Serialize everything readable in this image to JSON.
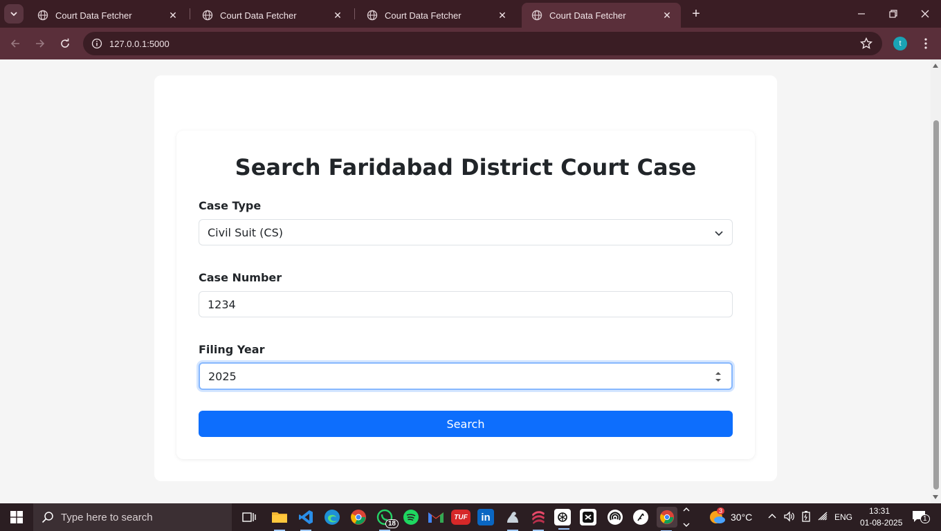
{
  "browser": {
    "tabs": [
      {
        "title": "Court Data Fetcher"
      },
      {
        "title": "Court Data Fetcher"
      },
      {
        "title": "Court Data Fetcher"
      },
      {
        "title": "Court Data Fetcher"
      }
    ],
    "active_tab_index": 3,
    "url": "127.0.0.1:5000",
    "profile_initial": "t",
    "theme_color": "#5a2f3a"
  },
  "form": {
    "title": "Search Faridabad District Court Case",
    "case_type": {
      "label": "Case Type",
      "value": "Civil Suit (CS)"
    },
    "case_number": {
      "label": "Case Number",
      "value": "1234"
    },
    "filing_year": {
      "label": "Filing Year",
      "value": "2025"
    },
    "submit_label": "Search",
    "accent_color": "#0d6efd"
  },
  "taskbar": {
    "search_placeholder": "Type here to search",
    "whatsapp_badge": "18",
    "weather_badge": "3",
    "temperature": "30°C",
    "language": "ENG",
    "time": "13:31",
    "date": "01-08-2025",
    "notification_count": "1",
    "tuf_label": "TUF",
    "linkedin_label": "in"
  }
}
